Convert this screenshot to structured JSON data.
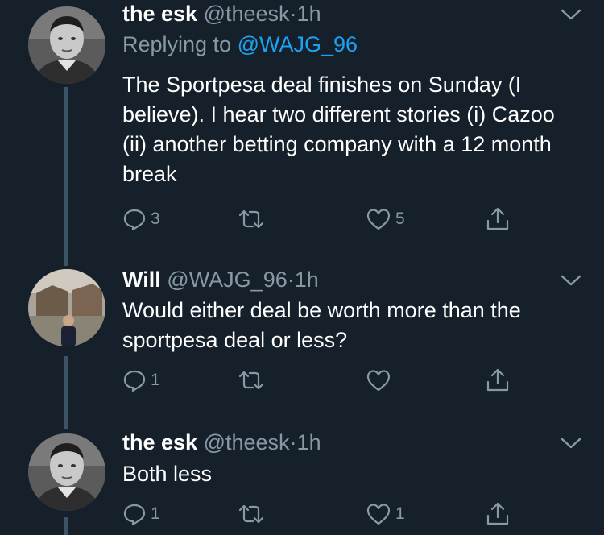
{
  "tweets": [
    {
      "name": "the esk",
      "handle": "@theesk",
      "time": "1h",
      "replying_prefix": "Replying to ",
      "replying_to": "@WAJG_96",
      "text": "The Sportpesa deal finishes on Sunday (I believe). I hear two different stories (i) Cazoo (ii) another betting company with a 12 month break",
      "reply_count": "3",
      "like_count": "5"
    },
    {
      "name": "Will",
      "handle": "@WAJG_96",
      "time": "1h",
      "text": "Would either deal be worth more than the sportpesa deal or less?",
      "reply_count": "1",
      "like_count": ""
    },
    {
      "name": "the esk",
      "handle": "@theesk",
      "time": "1h",
      "text": "Both less",
      "reply_count": "1",
      "like_count": "1"
    }
  ],
  "separator": "·",
  "icons": {
    "more": "chevron-down-icon",
    "reply": "reply-icon",
    "retweet": "retweet-icon",
    "like": "heart-icon",
    "share": "share-icon"
  },
  "colors": {
    "background": "#15202b",
    "secondary_text": "#8899a6",
    "link": "#1da1f2",
    "thread_line": "#3d5466"
  }
}
